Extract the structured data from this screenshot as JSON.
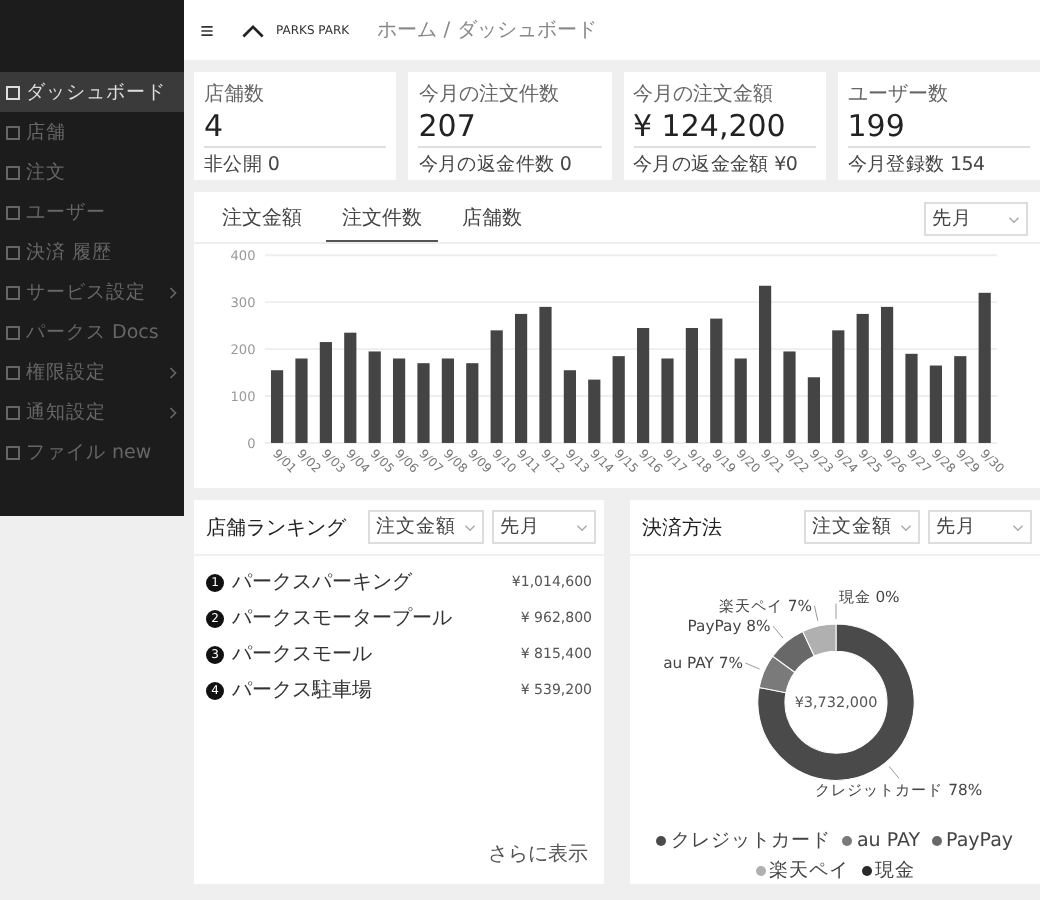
{
  "header": {
    "brand": "PARKS PARK",
    "breadcrumb": "ホーム / ダッシュボード"
  },
  "sidebar": {
    "items": [
      {
        "label": "ダッシュボード",
        "selected": true,
        "expandable": false
      },
      {
        "label": "店舗",
        "selected": false,
        "expandable": false
      },
      {
        "label": "注文",
        "selected": false,
        "expandable": false
      },
      {
        "label": "ユーザー",
        "selected": false,
        "expandable": false
      },
      {
        "label": "決済 履歴",
        "selected": false,
        "expandable": false
      },
      {
        "label": "サービス設定",
        "selected": false,
        "expandable": true
      },
      {
        "label": "パークス Docs",
        "selected": false,
        "expandable": false
      },
      {
        "label": "権限設定",
        "selected": false,
        "expandable": true
      },
      {
        "label": "通知設定",
        "selected": false,
        "expandable": true
      },
      {
        "label": "ファイル new",
        "selected": false,
        "expandable": false
      }
    ]
  },
  "stats": [
    {
      "label": "店舗数",
      "value": "4",
      "sub": "非公開 0"
    },
    {
      "label": "今月の注文件数",
      "value": "207",
      "sub": "今月の返金件数 0"
    },
    {
      "label": "今月の注文金額",
      "value": "¥ 124,200",
      "sub": "今月の返金金額 ¥0"
    },
    {
      "label": "ユーザー数",
      "value": "199",
      "sub": "今月登録数 154"
    }
  ],
  "chart_panel": {
    "tabs": [
      {
        "label": "注文金額",
        "selected": false
      },
      {
        "label": "注文件数",
        "selected": true
      },
      {
        "label": "店舗数",
        "selected": false
      }
    ],
    "period": "先月",
    "chart_data": {
      "type": "bar",
      "grid": true,
      "categories": [
        "9/01",
        "9/02",
        "9/03",
        "9/04",
        "9/05",
        "9/06",
        "9/07",
        "9/08",
        "9/09",
        "9/10",
        "9/11",
        "9/12",
        "9/13",
        "9/14",
        "9/15",
        "9/16",
        "9/17",
        "9/18",
        "9/19",
        "9/20",
        "9/21",
        "9/22",
        "9/23",
        "9/24",
        "9/25",
        "9/26",
        "9/27",
        "9/28",
        "9/29",
        "9/30"
      ],
      "values": [
        155,
        180,
        215,
        235,
        195,
        180,
        170,
        180,
        170,
        240,
        275,
        290,
        155,
        135,
        185,
        245,
        180,
        245,
        265,
        180,
        335,
        195,
        140,
        240,
        275,
        290,
        190,
        165,
        185,
        320
      ],
      "ylim": [
        0,
        400
      ],
      "yticks": [
        0,
        100,
        200,
        300,
        400
      ]
    }
  },
  "ranking": {
    "title": "店舗ランキング",
    "metric": "注文金額",
    "period": "先月",
    "items": [
      {
        "rank": "1",
        "name": "パークスパーキング",
        "amount": "¥1,014,600"
      },
      {
        "rank": "2",
        "name": "パークスモータープール",
        "amount": "¥ 962,800"
      },
      {
        "rank": "3",
        "name": "パークスモール",
        "amount": "¥ 815,400"
      },
      {
        "rank": "4",
        "name": "パークス駐車場",
        "amount": "¥ 539,200"
      }
    ],
    "more": "さらに表示"
  },
  "payment": {
    "title": "決済方法",
    "metric": "注文金額",
    "period": "先月",
    "chart_data": {
      "type": "donut",
      "title": "¥3,732,000",
      "categories": [
        "クレジットカード",
        "au PAY",
        "PayPay",
        "楽天ペイ",
        "現金"
      ],
      "values": [
        78,
        7,
        8,
        7,
        0
      ],
      "colors": [
        "#4a4a4a",
        "#7a7a7a",
        "#686868",
        "#b0b0b0",
        "#2a2a2a"
      ]
    },
    "slice_labels": [
      "現金 0%",
      "楽天ペイ 7%",
      "PayPay 8%",
      "au PAY 7%",
      "クレジットカード 78%"
    ]
  }
}
